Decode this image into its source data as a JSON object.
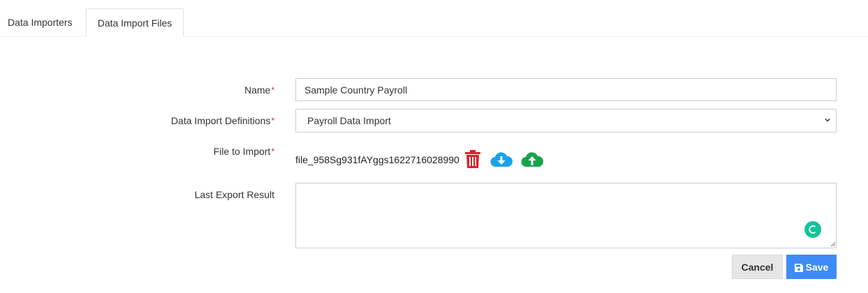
{
  "tabs": [
    {
      "label": "Data Importers"
    },
    {
      "label": "Data Import Files"
    }
  ],
  "form": {
    "name": {
      "label": "Name",
      "required_mark": "*",
      "value": "Sample Country Payroll"
    },
    "definitions": {
      "label": "Data Import Definitions",
      "required_mark": "*",
      "selected": "Payroll Data Import"
    },
    "file": {
      "label": "File to Import",
      "required_mark": "*",
      "filename": "file_958Sg931fAYggs1622716028990"
    },
    "last_export": {
      "label": "Last Export Result",
      "value": ""
    }
  },
  "icons": {
    "delete": "trash-icon",
    "download": "cloud-download-icon",
    "upload": "cloud-upload-icon",
    "save": "floppy-disk-icon",
    "assistant": "grammarly-icon"
  },
  "buttons": {
    "cancel": "Cancel",
    "save": "Save"
  },
  "colors": {
    "required": "#d9232d",
    "delete": "#d9232d",
    "download": "#1aa3e8",
    "upload": "#16a34a",
    "save_bg": "#3d8cf6",
    "cancel_bg": "#e6e6e6",
    "assistant": "#15c39a"
  }
}
